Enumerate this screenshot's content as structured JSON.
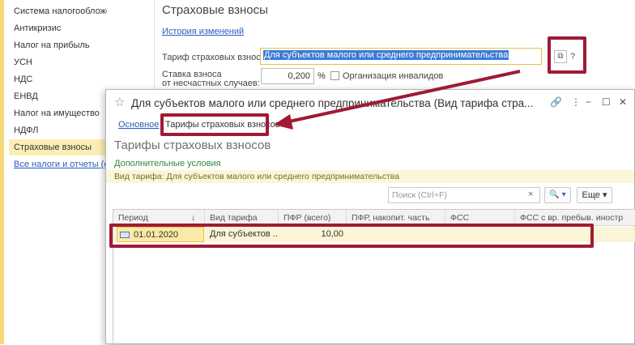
{
  "sidebar": {
    "items": [
      {
        "label": "Система налогообложения"
      },
      {
        "label": "Антикризис"
      },
      {
        "label": "Налог на прибыль"
      },
      {
        "label": "УСН"
      },
      {
        "label": "НДС"
      },
      {
        "label": "ЕНВД"
      },
      {
        "label": "Налог на имущество"
      },
      {
        "label": "НДФЛ"
      },
      {
        "label": "Страховые взносы"
      },
      {
        "label": "Все налоги и отчеты (еще)"
      }
    ],
    "active_index": 8
  },
  "form": {
    "title": "Страховые взносы",
    "history_link": "История изменений",
    "tariff_label": "Тариф страховых взносов:",
    "tariff_value": "Для субъектов малого или среднего предпринимательства",
    "open_icon": "open-window-icon",
    "help": "?",
    "rate_label_line1": "Ставка взноса",
    "rate_label_line2": "от несчастных случаев:",
    "rate_value": "0,200",
    "rate_unit": "%",
    "disabled_org_label": "Организация инвалидов"
  },
  "dialog": {
    "title": "Для субъектов малого или среднего предпринимательства (Вид тарифа стра...",
    "tabs": {
      "main": "Основное",
      "rates": "Тарифы страховых взносов"
    },
    "heading": "Тарифы страховых взносов",
    "additional_conditions": "Дополнительные условия",
    "info": "Вид тарифа: Для субъектов малого или среднего предпринимательства",
    "search_placeholder": "Поиск (Ctrl+F)",
    "search_clear": "×",
    "search_button": "🔍 ▾",
    "more_button": "Еще ▾",
    "table": {
      "columns": [
        "Период",
        "Вид тарифа",
        "ПФР (всего)",
        "ПФР, накопит. часть",
        "ФСС",
        "ФСС с вр. пребыв. иностр"
      ],
      "sort_indicator": "↓",
      "rows": [
        {
          "period": "01.01.2020",
          "tariff": "Для субъектов ...",
          "pfr_total": "10,00",
          "pfr_accum": "",
          "fss": "",
          "fss_foreign": ""
        }
      ]
    }
  },
  "colors": {
    "accent_red": "#a01a35",
    "link_blue": "#2c5cbc",
    "highlight_yellow": "#fbeeb5"
  }
}
